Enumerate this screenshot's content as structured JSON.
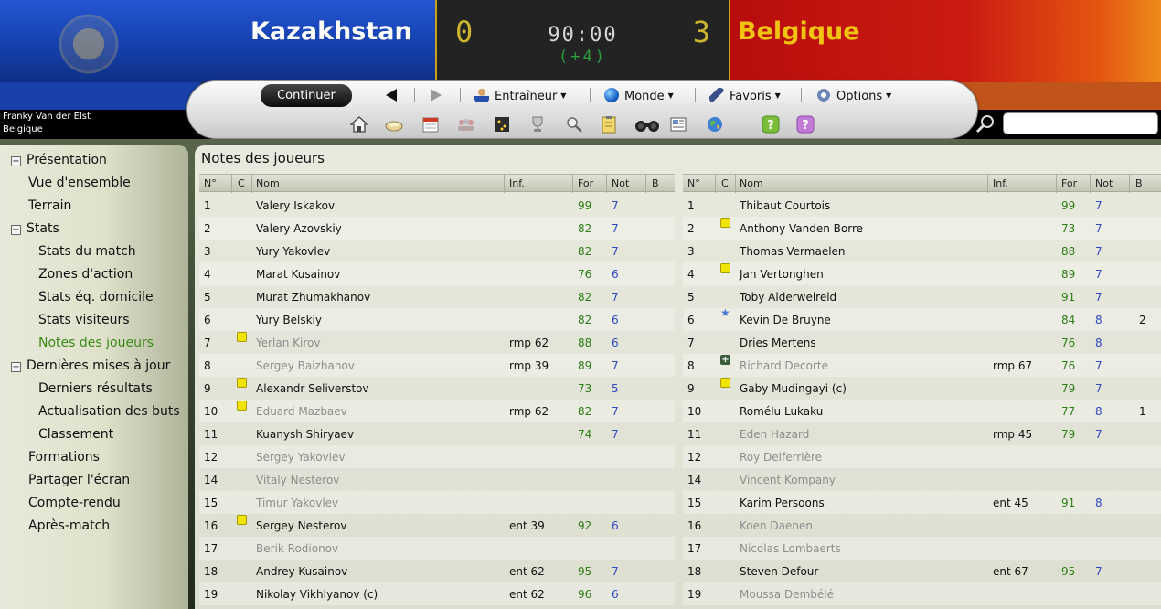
{
  "match": {
    "home_team": "Kazakhstan",
    "away_team": "Belgique",
    "home_score": "0",
    "away_score": "3",
    "clock": "90:00",
    "added_time": "(+4)"
  },
  "user": {
    "name": "Franky Van der Elst",
    "club": "Belgique"
  },
  "toolbar": {
    "continue_label": "Continuer",
    "menus": [
      "Entraîneur",
      "Monde",
      "Favoris",
      "Options"
    ]
  },
  "sidebar": {
    "items": [
      {
        "label": "Présentation",
        "expander": "+",
        "indent": 0,
        "active": false
      },
      {
        "label": "Vue d'ensemble",
        "expander": "",
        "indent": 0,
        "active": false
      },
      {
        "label": "Terrain",
        "expander": "",
        "indent": 0,
        "active": false
      },
      {
        "label": "Stats",
        "expander": "−",
        "indent": 0,
        "active": false
      },
      {
        "label": "Stats du match",
        "expander": "",
        "indent": 1,
        "active": false
      },
      {
        "label": "Zones d'action",
        "expander": "",
        "indent": 1,
        "active": false
      },
      {
        "label": "Stats éq. domicile",
        "expander": "",
        "indent": 1,
        "active": false
      },
      {
        "label": "Stats visiteurs",
        "expander": "",
        "indent": 1,
        "active": false
      },
      {
        "label": "Notes des joueurs",
        "expander": "",
        "indent": 1,
        "active": true
      },
      {
        "label": "Dernières mises à jour",
        "expander": "−",
        "indent": 0,
        "active": false
      },
      {
        "label": "Derniers résultats",
        "expander": "",
        "indent": 1,
        "active": false
      },
      {
        "label": "Actualisation des buts",
        "expander": "",
        "indent": 1,
        "active": false
      },
      {
        "label": "Classement",
        "expander": "",
        "indent": 1,
        "active": false
      },
      {
        "label": "Formations",
        "expander": "",
        "indent": 0,
        "active": false
      },
      {
        "label": "Partager l'écran",
        "expander": "",
        "indent": 0,
        "active": false
      },
      {
        "label": "Compte-rendu",
        "expander": "",
        "indent": 0,
        "active": false
      },
      {
        "label": "Après-match",
        "expander": "",
        "indent": 0,
        "active": false
      }
    ]
  },
  "panel": {
    "title": "Notes des joueurs",
    "columns": [
      "N°",
      "C",
      "Nom",
      "Inf.",
      "For",
      "Not",
      "B"
    ]
  },
  "home_players": [
    {
      "no": "1",
      "card": "",
      "name": "Valery Iskakov",
      "inf": "",
      "for": "99",
      "not": "7",
      "b": "",
      "sub": false
    },
    {
      "no": "2",
      "card": "",
      "name": "Valery Azovskiy",
      "inf": "",
      "for": "82",
      "not": "7",
      "b": "",
      "sub": false
    },
    {
      "no": "3",
      "card": "",
      "name": "Yury Yakovlev",
      "inf": "",
      "for": "82",
      "not": "7",
      "b": "",
      "sub": false
    },
    {
      "no": "4",
      "card": "",
      "name": "Marat Kusainov",
      "inf": "",
      "for": "76",
      "not": "6",
      "b": "",
      "sub": false
    },
    {
      "no": "5",
      "card": "",
      "name": "Murat Zhumakhanov",
      "inf": "",
      "for": "82",
      "not": "7",
      "b": "",
      "sub": false
    },
    {
      "no": "6",
      "card": "",
      "name": "Yury Belskiy",
      "inf": "",
      "for": "82",
      "not": "6",
      "b": "",
      "sub": false
    },
    {
      "no": "7",
      "card": "yellow",
      "name": "Yerlan Kirov",
      "inf": "rmp 62",
      "for": "88",
      "not": "6",
      "b": "",
      "sub": true
    },
    {
      "no": "8",
      "card": "",
      "name": "Sergey Baizhanov",
      "inf": "rmp 39",
      "for": "89",
      "not": "7",
      "b": "",
      "sub": true
    },
    {
      "no": "9",
      "card": "yellow",
      "name": "Alexandr Seliverstov",
      "inf": "",
      "for": "73",
      "not": "5",
      "b": "",
      "sub": false
    },
    {
      "no": "10",
      "card": "yellow",
      "name": "Eduard Mazbaev",
      "inf": "rmp 62",
      "for": "82",
      "not": "7",
      "b": "",
      "sub": true
    },
    {
      "no": "11",
      "card": "",
      "name": "Kuanysh Shiryaev",
      "inf": "",
      "for": "74",
      "not": "7",
      "b": "",
      "sub": false
    },
    {
      "no": "12",
      "card": "",
      "name": "Sergey Yakovlev",
      "inf": "",
      "for": "",
      "not": "",
      "b": "",
      "sub": true
    },
    {
      "no": "14",
      "card": "",
      "name": "Vitaly Nesterov",
      "inf": "",
      "for": "",
      "not": "",
      "b": "",
      "sub": true
    },
    {
      "no": "15",
      "card": "",
      "name": "Timur Yakovlev",
      "inf": "",
      "for": "",
      "not": "",
      "b": "",
      "sub": true
    },
    {
      "no": "16",
      "card": "yellow",
      "name": "Sergey Nesterov",
      "inf": "ent 39",
      "for": "92",
      "not": "6",
      "b": "",
      "sub": false
    },
    {
      "no": "17",
      "card": "",
      "name": "Berik Rodionov",
      "inf": "",
      "for": "",
      "not": "",
      "b": "",
      "sub": true
    },
    {
      "no": "18",
      "card": "",
      "name": "Andrey Kusainov",
      "inf": "ent 62",
      "for": "95",
      "not": "7",
      "b": "",
      "sub": false
    },
    {
      "no": "19",
      "card": "",
      "name": "Nikolay Vikhlyanov (c)",
      "inf": "ent 62",
      "for": "96",
      "not": "6",
      "b": "",
      "sub": false
    }
  ],
  "away_players": [
    {
      "no": "1",
      "card": "",
      "name": "Thibaut Courtois",
      "inf": "",
      "for": "99",
      "not": "7",
      "b": "",
      "sub": false
    },
    {
      "no": "2",
      "card": "yellow",
      "name": "Anthony Vanden Borre",
      "inf": "",
      "for": "73",
      "not": "7",
      "b": "",
      "sub": false
    },
    {
      "no": "3",
      "card": "",
      "name": "Thomas Vermaelen",
      "inf": "",
      "for": "88",
      "not": "7",
      "b": "",
      "sub": false
    },
    {
      "no": "4",
      "card": "yellow",
      "name": "Jan Vertonghen",
      "inf": "",
      "for": "89",
      "not": "7",
      "b": "",
      "sub": false
    },
    {
      "no": "5",
      "card": "",
      "name": "Toby Alderweireld",
      "inf": "",
      "for": "91",
      "not": "7",
      "b": "",
      "sub": false
    },
    {
      "no": "6",
      "card": "star",
      "name": "Kevin De Bruyne",
      "inf": "",
      "for": "84",
      "not": "8",
      "b": "2",
      "sub": false
    },
    {
      "no": "7",
      "card": "",
      "name": "Dries Mertens",
      "inf": "",
      "for": "76",
      "not": "8",
      "b": "",
      "sub": false
    },
    {
      "no": "8",
      "card": "injury",
      "name": "Richard Decorte",
      "inf": "rmp 67",
      "for": "76",
      "not": "7",
      "b": "",
      "sub": true
    },
    {
      "no": "9",
      "card": "yellow",
      "name": "Gaby Mudingayi (c)",
      "inf": "",
      "for": "79",
      "not": "7",
      "b": "",
      "sub": false
    },
    {
      "no": "10",
      "card": "",
      "name": "Romélu Lukaku",
      "inf": "",
      "for": "77",
      "not": "8",
      "b": "1",
      "sub": false
    },
    {
      "no": "11",
      "card": "",
      "name": "Eden Hazard",
      "inf": "rmp 45",
      "for": "79",
      "not": "7",
      "b": "",
      "sub": true
    },
    {
      "no": "12",
      "card": "",
      "name": "Roy Delferrière",
      "inf": "",
      "for": "",
      "not": "",
      "b": "",
      "sub": true
    },
    {
      "no": "14",
      "card": "",
      "name": "Vincent Kompany",
      "inf": "",
      "for": "",
      "not": "",
      "b": "",
      "sub": true
    },
    {
      "no": "15",
      "card": "",
      "name": "Karim Persoons",
      "inf": "ent 45",
      "for": "91",
      "not": "8",
      "b": "",
      "sub": false
    },
    {
      "no": "16",
      "card": "",
      "name": "Koen Daenen",
      "inf": "",
      "for": "",
      "not": "",
      "b": "",
      "sub": true
    },
    {
      "no": "17",
      "card": "",
      "name": "Nicolas Lombaerts",
      "inf": "",
      "for": "",
      "not": "",
      "b": "",
      "sub": true
    },
    {
      "no": "18",
      "card": "",
      "name": "Steven Defour",
      "inf": "ent 67",
      "for": "95",
      "not": "7",
      "b": "",
      "sub": false
    },
    {
      "no": "19",
      "card": "",
      "name": "Moussa Dembélé",
      "inf": "",
      "for": "",
      "not": "",
      "b": "",
      "sub": true
    }
  ],
  "colors": {
    "home_primary": "#1a49bd",
    "away_primary": "#c7150f",
    "away_text": "#f2c412",
    "rating_green": "#2e7c16",
    "note_blue": "#3048c0",
    "active_nav": "#3b8a18"
  },
  "icons": {
    "toolbar_nav": [
      "arrow-left-icon",
      "arrow-right-icon"
    ],
    "menus": [
      "coach-icon",
      "globe-icon",
      "bookmark-icon",
      "options-icon"
    ],
    "quick": [
      "home-icon",
      "inbox-icon",
      "calendar-icon",
      "squad-icon",
      "tactics-icon",
      "trophy-icon",
      "scout-icon",
      "clipboard-icon",
      "binoculars-icon",
      "newspaper-icon",
      "world-icon",
      "help-icon",
      "question-icon"
    ]
  }
}
